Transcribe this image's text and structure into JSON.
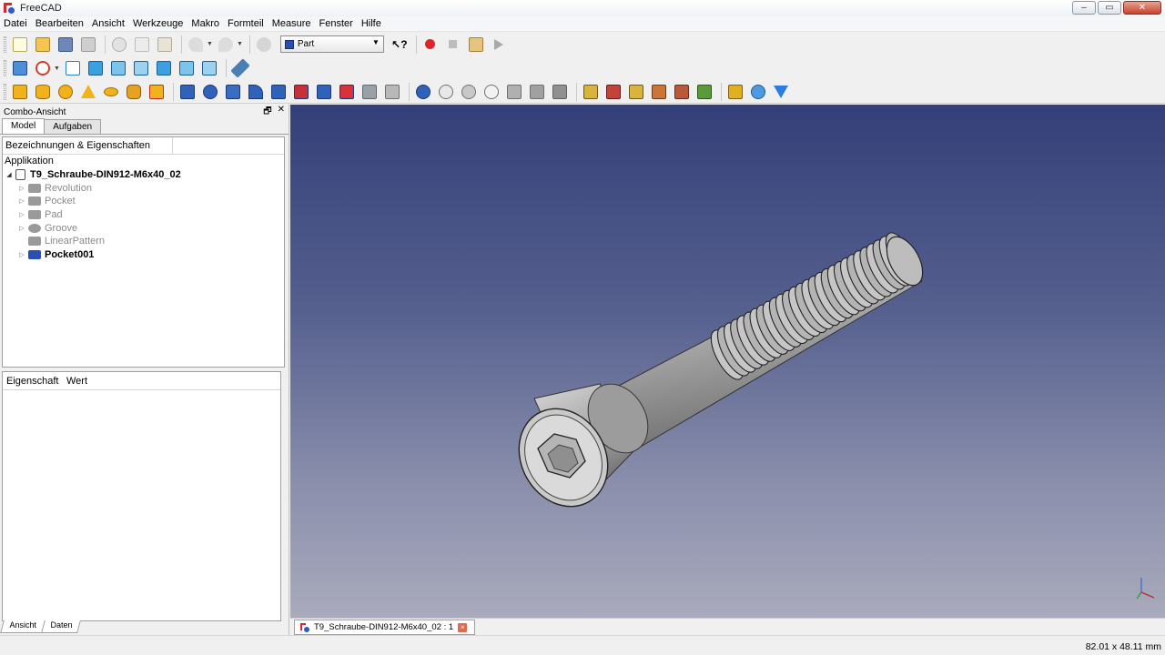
{
  "window": {
    "title": "FreeCAD",
    "minimize": "–",
    "maximize": "▭",
    "close": "✕"
  },
  "menu": [
    "Datei",
    "Bearbeiten",
    "Ansicht",
    "Werkzeuge",
    "Makro",
    "Formteil",
    "Measure",
    "Fenster",
    "Hilfe"
  ],
  "toolbar": {
    "workbench": "Part"
  },
  "colors": {
    "accent_blue": "#2a4fb4",
    "freecad_red": "#d8262c",
    "view_top": "#343f79",
    "view_bottom": "#a9aabc"
  },
  "combo": {
    "title": "Combo-Ansicht",
    "float_icon": "🗗",
    "close_icon": "✕",
    "tabs": [
      "Model",
      "Aufgaben"
    ],
    "tree_header": "Bezeichnungen & Eigenschaften",
    "tree_root": "Applikation",
    "document": "T9_Schraube-DIN912-M6x40_02",
    "features": [
      {
        "label": "Revolution",
        "icon": "revolution-icon"
      },
      {
        "label": "Pocket",
        "icon": "pocket-icon"
      },
      {
        "label": "Pad",
        "icon": "pad-icon"
      },
      {
        "label": "Groove",
        "icon": "groove-icon"
      },
      {
        "label": "LinearPattern",
        "icon": "linear-pattern-icon"
      },
      {
        "label": "Pocket001",
        "icon": "pocket-icon"
      }
    ],
    "props_headers": [
      "Eigenschaft",
      "Wert"
    ],
    "bottom_tabs": [
      "Ansicht",
      "Daten"
    ]
  },
  "doc_tab": {
    "label": "T9_Schraube-DIN912-M6x40_02 : 1"
  },
  "status": {
    "dimensions": "82.01 x 48.11 mm"
  }
}
